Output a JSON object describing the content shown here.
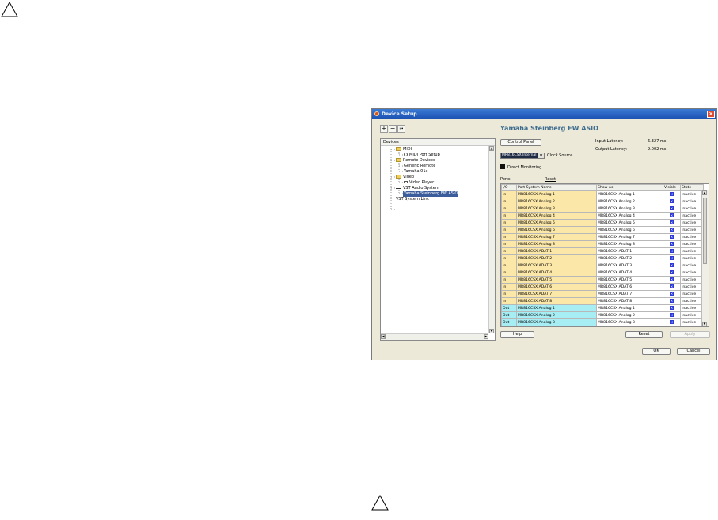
{
  "window": {
    "title": "Device Setup",
    "close": "×",
    "toolbar": {
      "add": "+",
      "remove": "−",
      "reset": "⏮"
    },
    "devices": {
      "header": "Devices",
      "tree": [
        {
          "label": "MIDI",
          "folder": true
        },
        {
          "label": "MIDI Port Setup",
          "folder": false
        },
        {
          "label": "Remote Devices",
          "folder": true
        },
        {
          "label": "Generic Remote",
          "folder": false
        },
        {
          "label": "Yamaha 01x",
          "folder": false
        },
        {
          "label": "Video",
          "folder": true
        },
        {
          "label": "Video Player",
          "folder": false
        },
        {
          "label": "VST Audio System",
          "folder": false
        },
        {
          "label": "Yamaha Steinberg FW ASIO",
          "folder": false,
          "selected": true
        },
        {
          "label": "VST System Link",
          "folder": false
        }
      ]
    },
    "panel": {
      "heading": "Yamaha Steinberg FW ASIO",
      "control_panel": "Control Panel",
      "input_latency_label": "Input Latency:",
      "input_latency_value": "6.327 ms",
      "output_latency_label": "Output Latency:",
      "output_latency_value": "9.002 ms",
      "clock_value": "MR816CSX Internal",
      "clock_label": "Clock Source",
      "direct_monitoring": "Direct Monitoring",
      "ports_label": "Ports",
      "reset_link": "Reset"
    },
    "table": {
      "headers": [
        "I/O",
        "Port System Name",
        "Show As",
        "Visible",
        "State"
      ],
      "rows": [
        {
          "io": "In",
          "name": "MR816CSX Analog 1",
          "show": "MR816CSX Analog 1",
          "state": "Inactive"
        },
        {
          "io": "In",
          "name": "MR816CSX Analog 2",
          "show": "MR816CSX Analog 2",
          "state": "Inactive"
        },
        {
          "io": "In",
          "name": "MR816CSX Analog 3",
          "show": "MR816CSX Analog 3",
          "state": "Inactive"
        },
        {
          "io": "In",
          "name": "MR816CSX Analog 4",
          "show": "MR816CSX Analog 4",
          "state": "Inactive"
        },
        {
          "io": "In",
          "name": "MR816CSX Analog 5",
          "show": "MR816CSX Analog 5",
          "state": "Inactive"
        },
        {
          "io": "In",
          "name": "MR816CSX Analog 6",
          "show": "MR816CSX Analog 6",
          "state": "Inactive"
        },
        {
          "io": "In",
          "name": "MR816CSX Analog 7",
          "show": "MR816CSX Analog 7",
          "state": "Inactive"
        },
        {
          "io": "In",
          "name": "MR816CSX Analog 8",
          "show": "MR816CSX Analog 8",
          "state": "Inactive"
        },
        {
          "io": "In",
          "name": "MR816CSX ADAT 1",
          "show": "MR816CSX ADAT 1",
          "state": "Inactive"
        },
        {
          "io": "In",
          "name": "MR816CSX ADAT 2",
          "show": "MR816CSX ADAT 2",
          "state": "Inactive"
        },
        {
          "io": "In",
          "name": "MR816CSX ADAT 3",
          "show": "MR816CSX ADAT 3",
          "state": "Inactive"
        },
        {
          "io": "In",
          "name": "MR816CSX ADAT 4",
          "show": "MR816CSX ADAT 4",
          "state": "Inactive"
        },
        {
          "io": "In",
          "name": "MR816CSX ADAT 5",
          "show": "MR816CSX ADAT 5",
          "state": "Inactive"
        },
        {
          "io": "In",
          "name": "MR816CSX ADAT 6",
          "show": "MR816CSX ADAT 6",
          "state": "Inactive"
        },
        {
          "io": "In",
          "name": "MR816CSX ADAT 7",
          "show": "MR816CSX ADAT 7",
          "state": "Inactive"
        },
        {
          "io": "In",
          "name": "MR816CSX ADAT 8",
          "show": "MR816CSX ADAT 8",
          "state": "Inactive"
        },
        {
          "io": "Out",
          "name": "MR816CSX Analog 1",
          "show": "MR816CSX Analog 1",
          "state": "Inactive"
        },
        {
          "io": "Out",
          "name": "MR816CSX Analog 2",
          "show": "MR816CSX Analog 2",
          "state": "Inactive"
        },
        {
          "io": "Out",
          "name": "MR816CSX Analog 3",
          "show": "MR816CSX Analog 3",
          "state": "Inactive"
        }
      ]
    },
    "buttons": {
      "help": "Help",
      "reset": "Reset",
      "apply": "Apply",
      "ok": "OK",
      "cancel": "Cancel"
    }
  }
}
